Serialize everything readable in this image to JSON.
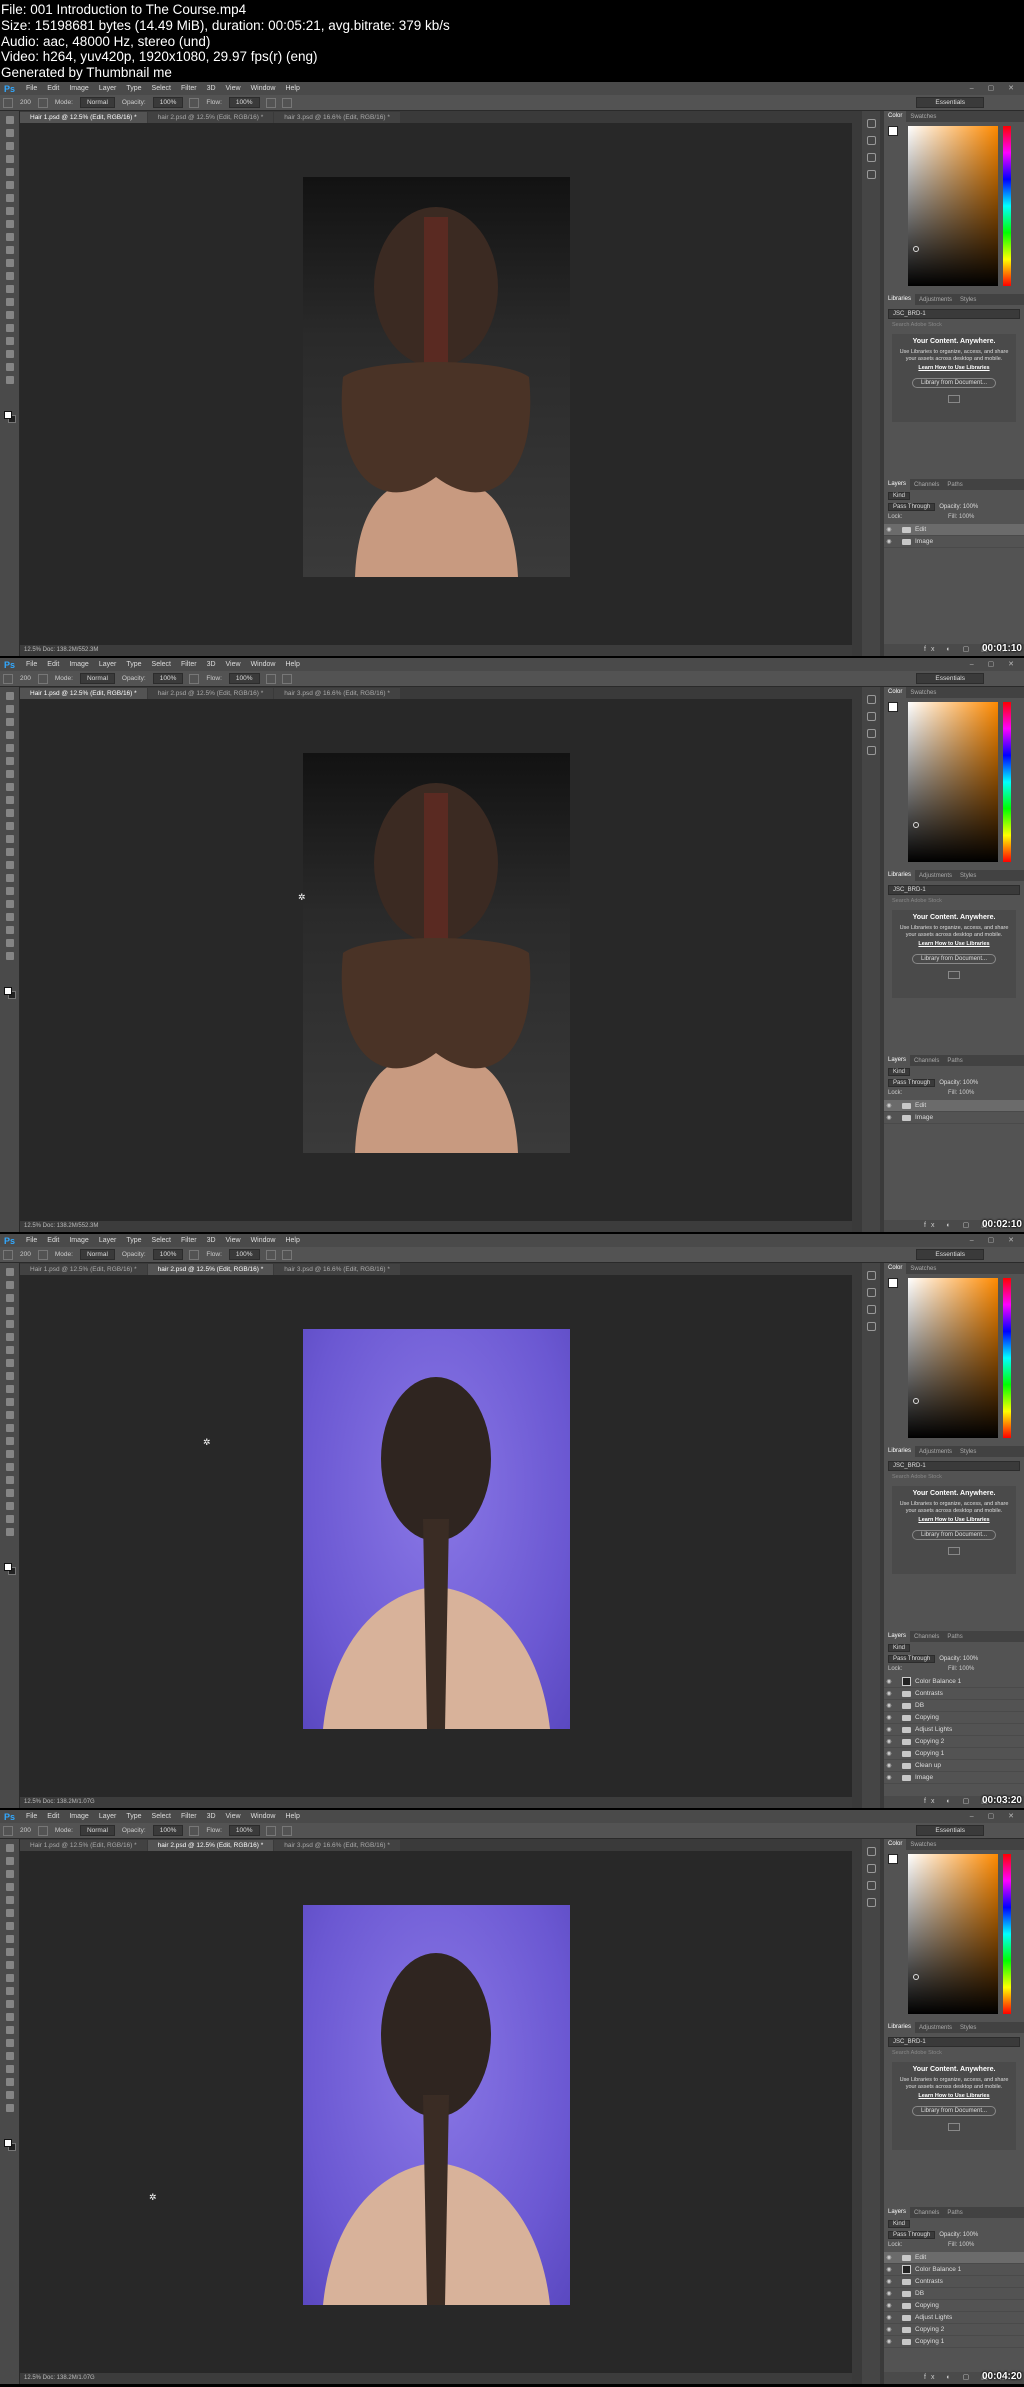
{
  "header": {
    "line1": "File: 001 Introduction to The Course.mp4",
    "line2": "Size: 15198681 bytes (14.49 MiB), duration: 00:05:21, avg.bitrate: 379 kb/s",
    "line3": "Audio: aac, 48000 Hz, stereo (und)",
    "line4": "Video: h264, yuv420p, 1920x1080, 29.97 fps(r) (eng)",
    "line5": "Generated by Thumbnail me"
  },
  "app": {
    "logo": "Ps",
    "menu": [
      "File",
      "Edit",
      "Image",
      "Layer",
      "Type",
      "Select",
      "Filter",
      "3D",
      "View",
      "Window",
      "Help"
    ],
    "window_controls": "– ▢ ✕",
    "options": {
      "mode_label": "Mode:",
      "mode_value": "Normal",
      "opacity_label": "Opacity:",
      "opacity_value": "100%",
      "flow_label": "Flow:",
      "flow_value": "100%",
      "brush_size": "200"
    },
    "workspace": "Essentials",
    "tabs": [
      "Hair 1.psd @ 12.5% (Edit, RGB/16) *",
      "hair 2.psd @ 12.5% (Edit, RGB/16) *",
      "hair 3.psd @ 16.6% (Edit, RGB/16) *"
    ],
    "panel_tabs_color": [
      "Color",
      "Swatches"
    ],
    "panel_tabs_libraries": [
      "Libraries",
      "Adjustments",
      "Styles"
    ],
    "panel_tabs_layers": [
      "Layers",
      "Channels",
      "Paths"
    ],
    "library_name": "JSC_BRD-1",
    "library_search": "Search Adobe Stock",
    "promo_title": "Your Content. Anywhere.",
    "promo_body": "Use Libraries to organize, access, and share your assets across desktop and mobile.",
    "promo_link": "Learn How to Use Libraries",
    "promo_button": "Library from Document...",
    "layers_kind": "Kind",
    "layers_blend": "Pass Through",
    "layers_opacity": "Opacity: 100%",
    "layers_lock": "Lock:",
    "layers_fill": "Fill: 100%",
    "layers_footer": "fx ◐ ▢ ▣ ⬚ 🗑"
  },
  "frames": [
    {
      "active_tab": 0,
      "doc_kind": "dark",
      "status": "12.5%   Doc: 138.2M/552.3M",
      "timestamp": "00:01:10",
      "layers": [
        {
          "name": "Edit",
          "kind": "folder",
          "visible": true,
          "selected": true
        },
        {
          "name": "Image",
          "kind": "folder",
          "visible": true,
          "selected": false
        }
      ]
    },
    {
      "active_tab": 0,
      "doc_kind": "dark",
      "status": "12.5%   Doc: 138.2M/552.3M",
      "timestamp": "00:02:10",
      "layers": [
        {
          "name": "Edit",
          "kind": "folder",
          "visible": true,
          "selected": true
        },
        {
          "name": "Image",
          "kind": "folder",
          "visible": true,
          "selected": false
        }
      ]
    },
    {
      "active_tab": 1,
      "doc_kind": "purple",
      "status": "12.5%   Doc: 138.2M/1.07G",
      "timestamp": "00:03:20",
      "layers": [
        {
          "name": "Color Balance 1",
          "kind": "adjustment",
          "visible": true,
          "selected": false
        },
        {
          "name": "Contrasts",
          "kind": "folder",
          "visible": true,
          "selected": false
        },
        {
          "name": "DB",
          "kind": "folder",
          "visible": true,
          "selected": false
        },
        {
          "name": "Copying",
          "kind": "folder",
          "visible": true,
          "selected": false
        },
        {
          "name": "Adjust Lights",
          "kind": "folder",
          "visible": true,
          "selected": false
        },
        {
          "name": "Copying 2",
          "kind": "folder",
          "visible": true,
          "selected": false
        },
        {
          "name": "Copying 1",
          "kind": "folder",
          "visible": true,
          "selected": false
        },
        {
          "name": "Clean up",
          "kind": "folder",
          "visible": true,
          "selected": false
        },
        {
          "name": "Image",
          "kind": "folder",
          "visible": true,
          "selected": false
        }
      ]
    },
    {
      "active_tab": 1,
      "doc_kind": "purple",
      "status": "12.5%   Doc: 138.2M/1.07G",
      "timestamp": "00:04:20",
      "layers": [
        {
          "name": "Edit",
          "kind": "folder",
          "visible": true,
          "selected": true
        },
        {
          "name": "Color Balance 1",
          "kind": "adjustment",
          "visible": true,
          "selected": false
        },
        {
          "name": "Contrasts",
          "kind": "folder",
          "visible": true,
          "selected": false
        },
        {
          "name": "DB",
          "kind": "folder",
          "visible": true,
          "selected": false
        },
        {
          "name": "Copying",
          "kind": "folder",
          "visible": true,
          "selected": false
        },
        {
          "name": "Adjust Lights",
          "kind": "folder",
          "visible": true,
          "selected": false
        },
        {
          "name": "Copying 2",
          "kind": "folder",
          "visible": true,
          "selected": false
        },
        {
          "name": "Copying 1",
          "kind": "folder",
          "visible": true,
          "selected": false
        }
      ]
    }
  ]
}
